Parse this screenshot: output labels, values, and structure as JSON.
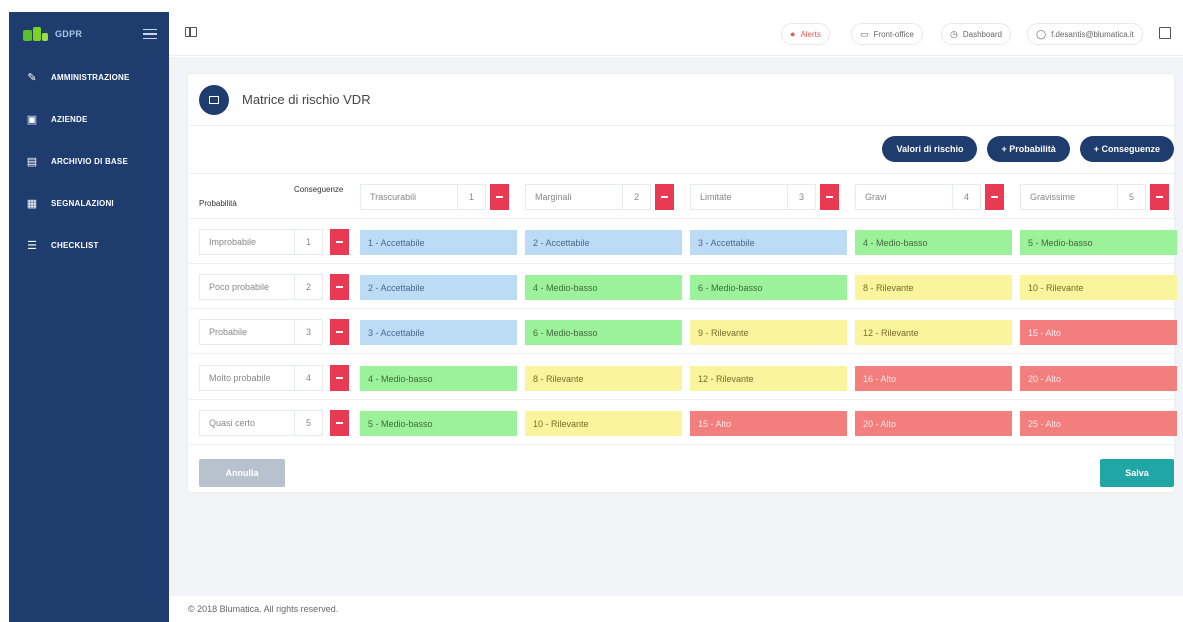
{
  "app": {
    "name": "GDPR"
  },
  "sidebar": {
    "items": [
      {
        "label": "AMMINISTRAZIONE",
        "icon": "wrench-icon"
      },
      {
        "label": "AZIENDE",
        "icon": "briefcase-icon"
      },
      {
        "label": "ARCHIVIO DI BASE",
        "icon": "archive-icon"
      },
      {
        "label": "SEGNALAZIONI",
        "icon": "report-icon"
      },
      {
        "label": "CHECKLIST",
        "icon": "checklist-icon"
      }
    ]
  },
  "header": {
    "alerts": "Alerts",
    "frontoffice": "Front-office",
    "dashboard": "Dashboard",
    "user": "f.desantis@blumatica.it"
  },
  "page": {
    "title": "Matrice di rischio VDR",
    "buttons": {
      "valori": "Valori di rischio",
      "probabilita": "+ Probabilità",
      "conseguenze": "+ Conseguenze"
    },
    "label_probabilita": "Probabilità",
    "label_conseguenze": "Conseguenze",
    "consequences": [
      {
        "label": "Trascurabili",
        "value": "1"
      },
      {
        "label": "Marginali",
        "value": "2"
      },
      {
        "label": "Limitate",
        "value": "3"
      },
      {
        "label": "Gravi",
        "value": "4"
      },
      {
        "label": "Gravissime",
        "value": "5"
      }
    ],
    "probabilities": [
      {
        "label": "Improbabile",
        "value": "1"
      },
      {
        "label": "Poco probabile",
        "value": "2"
      },
      {
        "label": "Probabile",
        "value": "3"
      },
      {
        "label": "Molto probabile",
        "value": "4"
      },
      {
        "label": "Quasi certo",
        "value": "5"
      }
    ],
    "matrix": [
      [
        "1 - Accettabile",
        "2 - Accettabile",
        "3 - Accettabile",
        "4 - Medio-basso",
        "5 - Medio-basso"
      ],
      [
        "2 - Accettabile",
        "4 - Medio-basso",
        "6 - Medio-basso",
        "8 - Rilevante",
        "10 - Rilevante"
      ],
      [
        "3 - Accettabile",
        "6 - Medio-basso",
        "9 - Rilevante",
        "12 - Rilevante",
        "15 - Alto"
      ],
      [
        "4 - Medio-basso",
        "8 - Rilevante",
        "12 - Rilevante",
        "16 - Alto",
        "20 - Alto"
      ],
      [
        "5 - Medio-basso",
        "10 - Rilevante",
        "15 - Alto",
        "20 - Alto",
        "25 - Alto"
      ]
    ],
    "levels": {
      "Accettabile": {
        "bg": "#bcdcf6",
        "fg": "#4a6a8a"
      },
      "Medio-basso": {
        "bg": "#9cf19b",
        "fg": "#3f6b3c"
      },
      "Rilevante": {
        "bg": "#faf59c",
        "fg": "#7a6a2a"
      },
      "Alto": {
        "bg": "#f27f7d",
        "fg": "#fde6e5"
      }
    },
    "annulla": "Annulla",
    "salva": "Salva"
  },
  "footer": {
    "text": "© 2018 Blumatica. All rights reserved."
  }
}
